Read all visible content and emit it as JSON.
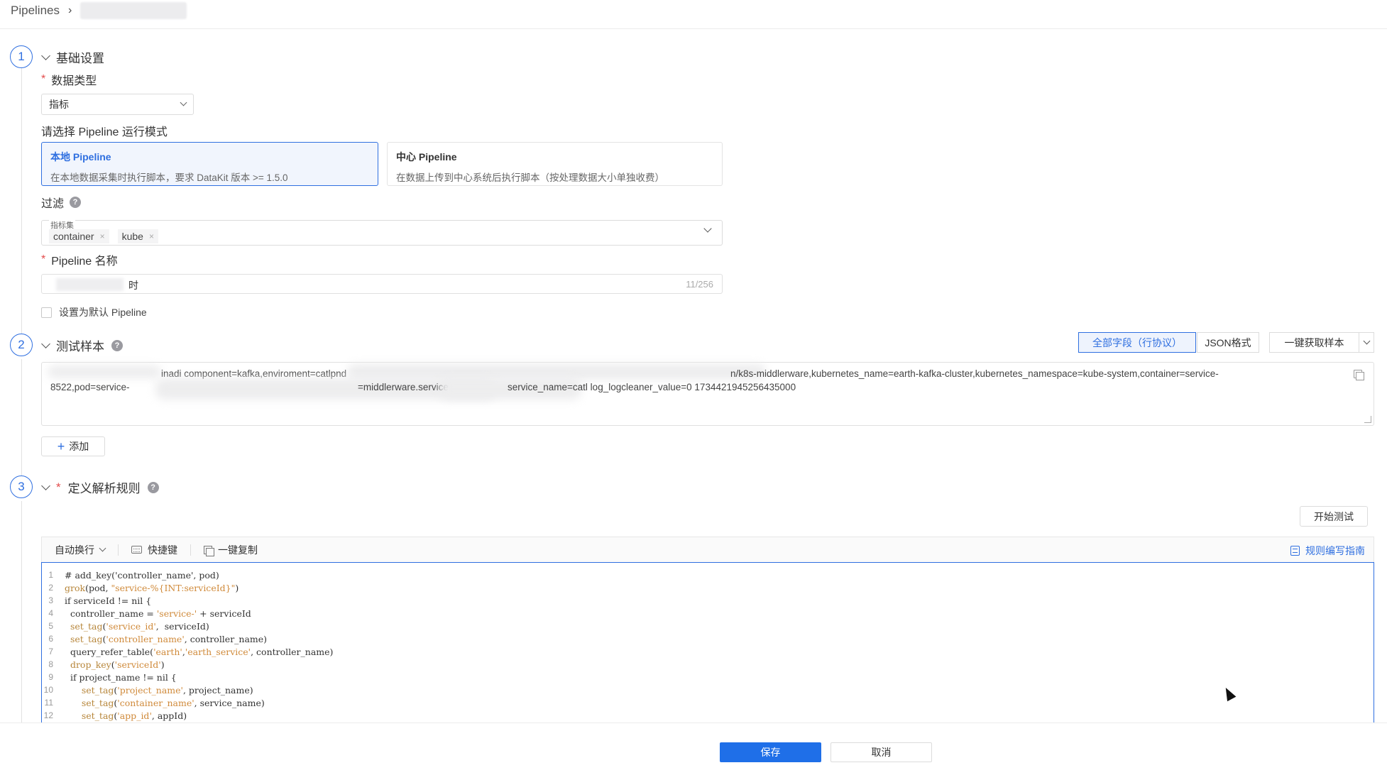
{
  "breadcrumb": {
    "root": "Pipelines",
    "separator": "›"
  },
  "sections": {
    "basic": {
      "number": "1",
      "title": "基础设置"
    },
    "sample": {
      "number": "2",
      "title": "测试样本"
    },
    "rules": {
      "number": "3",
      "required_mark": "*",
      "title": "定义解析规则"
    }
  },
  "data_type": {
    "label": "数据类型",
    "required_mark": "*",
    "value": "指标"
  },
  "run_mode": {
    "label": "请选择 Pipeline 运行模式",
    "options": [
      {
        "title": "本地 Pipeline",
        "desc": "在本地数据采集时执行脚本，要求 DataKit 版本 >= 1.5.0",
        "selected": true
      },
      {
        "title": "中心 Pipeline",
        "desc": "在数据上传到中心系统后执行脚本（按处理数据大小单独收费）",
        "selected": false
      }
    ]
  },
  "filter": {
    "label": "过滤",
    "field_label": "指标集",
    "tags": [
      "container",
      "kube"
    ],
    "tag_remove": "×"
  },
  "pipeline_name": {
    "label": "Pipeline 名称",
    "required_mark": "*",
    "value_visible": "时",
    "counter": "11/256"
  },
  "default_checkbox": {
    "label": "设置为默认 Pipeline",
    "checked": false
  },
  "sample_toolbar": {
    "all_fields": "全部字段（行协议）",
    "json_format": "JSON格式",
    "fetch_sample": "一键获取样本"
  },
  "sample_text": {
    "line1_a": "inadi component=kafka,enviroment=catlpnd",
    "line1_b": "n/k8s-middlerware,kubernetes_name=earth-kafka-cluster,kubernetes_namespace=kube-system,container=service-",
    "line2_a": "8522,pod=service-",
    "line2_b": "=middlerware.service",
    "line2_c": "service_name=catl log_logcleaner_value=0 1734421945256435000"
  },
  "add_button": {
    "icon": "+",
    "label": "添加"
  },
  "start_test": "开始测试",
  "editor_toolbar": {
    "wrap": "自动换行",
    "shortcuts": "快捷键",
    "copy_all": "一键复制",
    "guide": "规则编写指南"
  },
  "code_lines": [
    "1",
    "2",
    "3",
    "4",
    "5",
    "6",
    "7",
    "8",
    "9",
    "10",
    "11",
    "12"
  ],
  "code": {
    "l1": "# add_key('controller_name', pod)",
    "l2_fn": "grok",
    "l2_a": "(pod, ",
    "l2_str": "\"service-%{INT:serviceId}\"",
    "l2_b": ")",
    "l3": "if serviceId != nil {",
    "l4_a": "  controller_name = ",
    "l4_str": "'service-'",
    "l4_b": " + serviceId",
    "l5_fn": "  set_tag",
    "l5_a": "(",
    "l5_str": "'service_id'",
    "l5_b": ",  serviceId)",
    "l6_fn": "  set_tag",
    "l6_a": "(",
    "l6_str": "'controller_name'",
    "l6_b": ", controller_name)",
    "l7_a": "  query_refer_table(",
    "l7_str1": "'earth'",
    "l7_b": ",",
    "l7_str2": "'earth_service'",
    "l7_c": ", controller_name)",
    "l8_fn": "  drop_key",
    "l8_a": "(",
    "l8_str": "'serviceId'",
    "l8_b": ")",
    "l9": "  if project_name != nil {",
    "l10_fn": "      set_tag",
    "l10_a": "(",
    "l10_str": "'project_name'",
    "l10_b": ", project_name)",
    "l11_fn": "      set_tag",
    "l11_a": "(",
    "l11_str": "'container_name'",
    "l11_b": ", service_name)",
    "l12_fn": "      set_tag",
    "l12_a": "(",
    "l12_str": "'app_id'",
    "l12_b": ", appId)"
  },
  "footer": {
    "save": "保存",
    "cancel": "取消"
  },
  "colors": {
    "accent": "#2f6fe0",
    "primary_button": "#1f6fe8",
    "required": "#e34d4d"
  }
}
